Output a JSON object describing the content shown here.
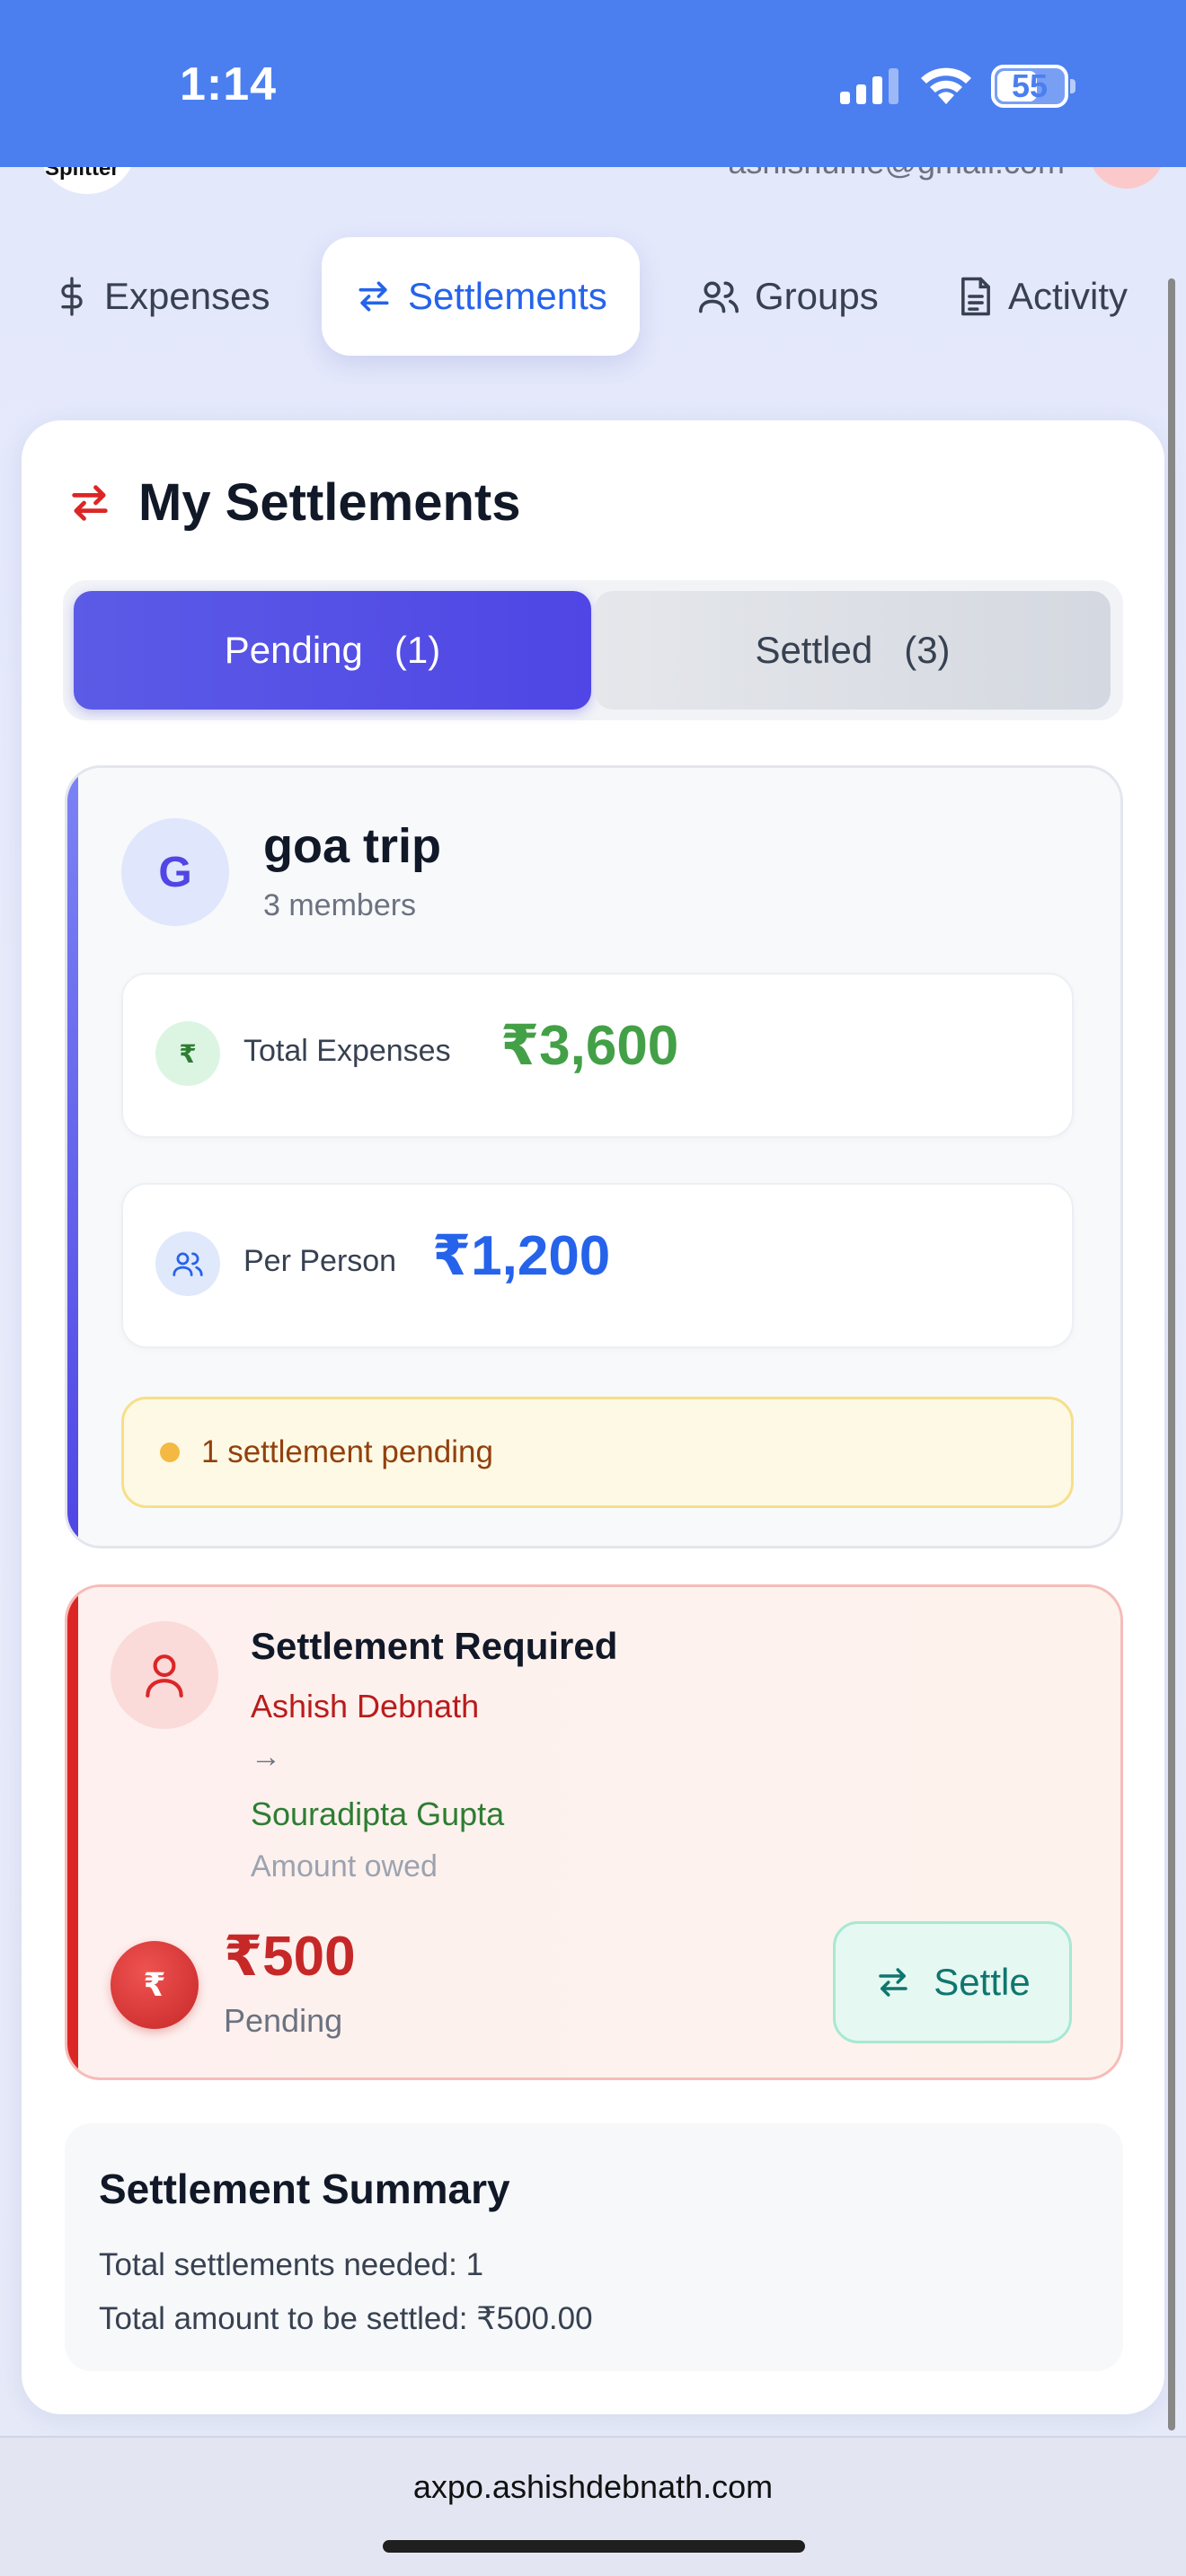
{
  "status_bar": {
    "time": "1:14",
    "battery": "55"
  },
  "header": {
    "logo_text": "Splitter",
    "email": "ashishume@gmail.com"
  },
  "tabs": [
    {
      "label": "Expenses",
      "icon": "dollar-icon"
    },
    {
      "label": "Settlements",
      "icon": "swap-arrows-icon",
      "active": true
    },
    {
      "label": "Groups",
      "icon": "users-icon"
    },
    {
      "label": "Activity",
      "icon": "document-icon"
    }
  ],
  "page": {
    "title": "My Settlements",
    "toggle": {
      "pending_label": "Pending   (1)",
      "settled_label": "Settled   (3)",
      "selected": "pending"
    }
  },
  "group": {
    "initial": "G",
    "name": "goa trip",
    "members": "3 members",
    "total_label": "Total Expenses",
    "total_value": "₹3,600",
    "per_person_label": "Per Person",
    "per_person_value": "₹1,200",
    "pending_note": "1 settlement pending"
  },
  "settlement": {
    "title": "Settlement Required",
    "from": "Ashish Debnath",
    "arrow": "→",
    "to": "Souradipta Gupta",
    "owed_label": "Amount owed",
    "currency_symbol": "₹",
    "amount": "₹500",
    "status": "Pending",
    "settle_label": "Settle"
  },
  "summary": {
    "title": "Settlement Summary",
    "line1": "Total settlements needed: 1",
    "line2": "Total amount to be settled: ₹500.00"
  },
  "browser": {
    "url": "axpo.ashishdebnath.com"
  },
  "colors": {
    "accent": "#4f46e5",
    "brand_blue": "#4b7ff0",
    "green": "#43a047",
    "blue_value": "#2563eb",
    "red": "#c62828",
    "teal": "#0f766e"
  }
}
